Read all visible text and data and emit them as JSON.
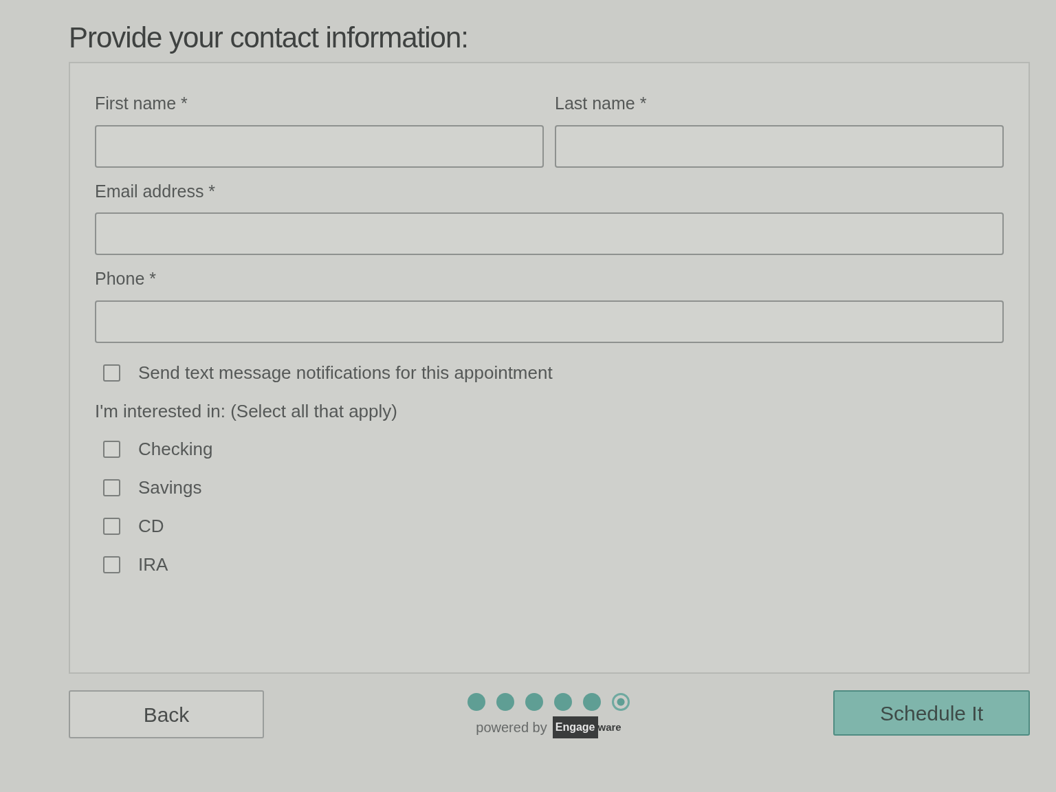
{
  "title": "Provide your contact information:",
  "field_rows": [
    [
      {
        "label": "First name *"
      },
      {
        "label": "Last name *"
      }
    ],
    [
      {
        "label": "Email address *"
      }
    ],
    [
      {
        "label": "Phone *"
      }
    ]
  ],
  "sms": {
    "label": "Send text message notifications for this appointment",
    "checked": false
  },
  "interest_label": "I'm interested in: (Select all that apply)",
  "interests": [
    {
      "label": "Checking",
      "checked": false
    },
    {
      "label": "Savings",
      "checked": false
    },
    {
      "label": "CD",
      "checked": false
    },
    {
      "label": "IRA",
      "checked": false
    }
  ],
  "back_button": "Back",
  "steps": [
    {
      "completed": true
    },
    {
      "completed": true
    },
    {
      "completed": true
    },
    {
      "completed": true
    },
    {
      "completed": true
    },
    {
      "completed": false
    }
  ],
  "powered_by": "powered by",
  "logo": {
    "dark_part": "Engage",
    "light_part": "ware"
  },
  "submit_button": "Schedule It"
}
